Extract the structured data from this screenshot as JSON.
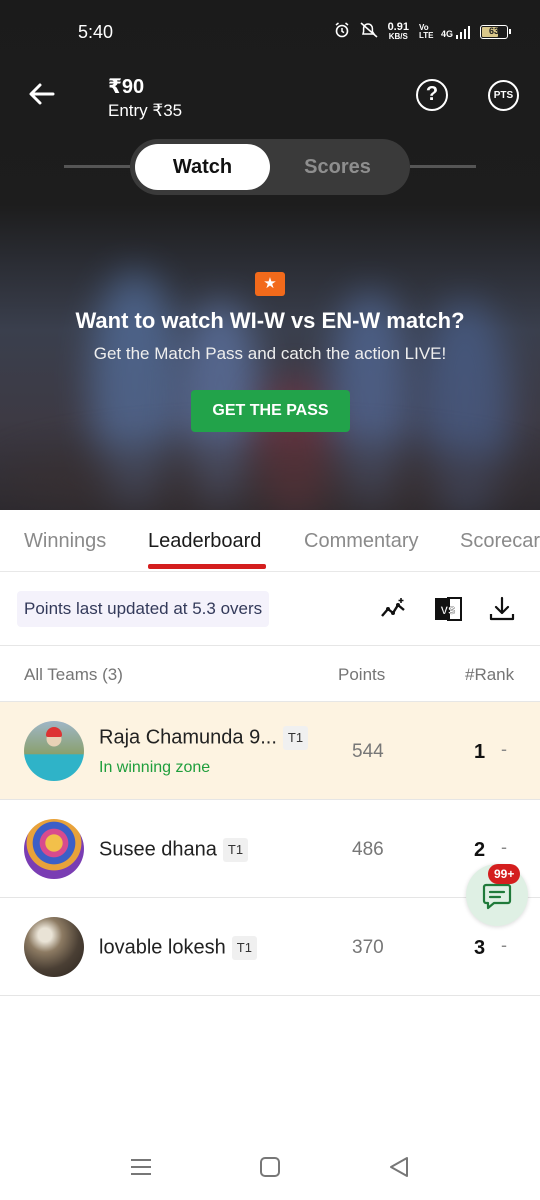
{
  "status_bar": {
    "time": "5:40",
    "net_speed_value": "0.91",
    "net_speed_unit": "KB/S",
    "network": "4G",
    "volte": "Vo LTE",
    "battery": "63"
  },
  "header": {
    "prize": "₹90",
    "entry": "Entry ₹35",
    "pts_label": "PTS",
    "help_glyph": "?"
  },
  "segment": {
    "watch": "Watch",
    "scores": "Scores"
  },
  "promo": {
    "title": "Want to watch WI-W vs EN-W match?",
    "subtitle": "Get the Match Pass and catch the action LIVE!",
    "button": "GET THE PASS"
  },
  "tabs": [
    "Winnings",
    "Leaderboard",
    "Commentary",
    "Scorecard"
  ],
  "update_text": "Points last updated at 5.3 overs",
  "vs_label": "VS",
  "columns": {
    "teams": "All Teams (3)",
    "points": "Points",
    "rank": "#Rank"
  },
  "rows": [
    {
      "name": "Raja Chamunda 9...",
      "team": "T1",
      "status": "In winning zone",
      "points": "544",
      "rank": "1",
      "trend": "-"
    },
    {
      "name": "Susee dhana",
      "team": "T1",
      "points": "486",
      "rank": "2",
      "trend": "-"
    },
    {
      "name": "lovable lokesh",
      "team": "T1",
      "points": "370",
      "rank": "3",
      "trend": "-"
    }
  ],
  "chat_badge": "99+",
  "colors": {
    "accent_red": "#d41e1e",
    "pass_green": "#22a34a",
    "winning_green": "#1f9e3c",
    "highlight_row": "#fdf3e1"
  }
}
